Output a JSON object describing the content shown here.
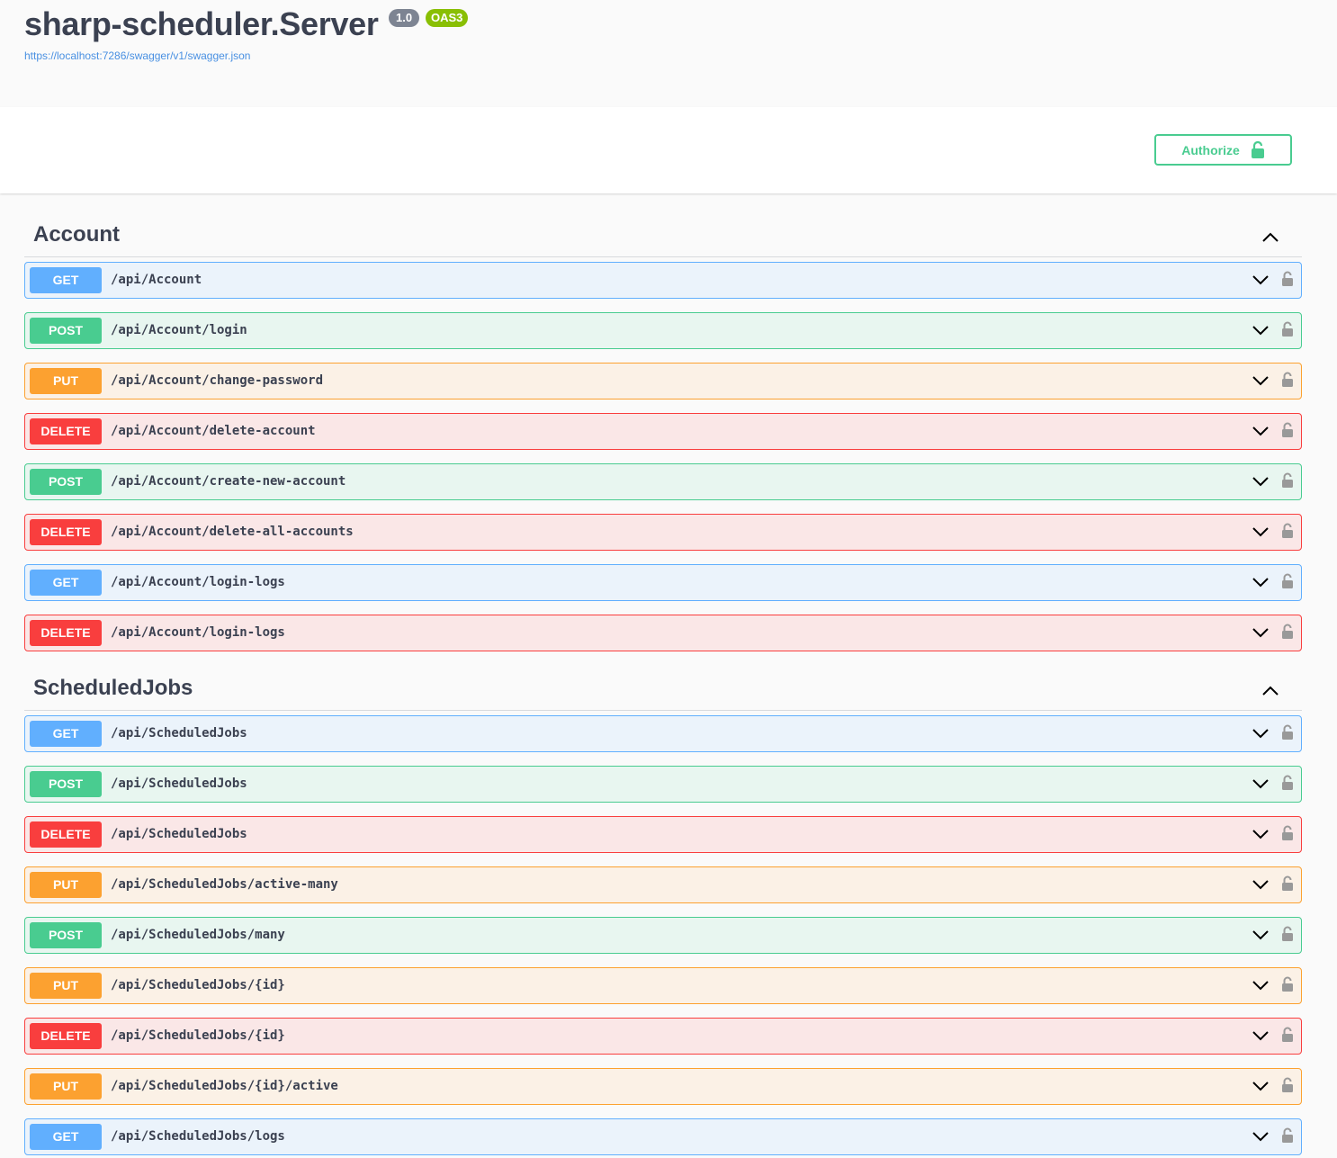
{
  "header": {
    "title": "sharp-scheduler.Server",
    "version": "1.0",
    "oas": "OAS3",
    "spec_url": "https://localhost:7286/swagger/v1/swagger.json"
  },
  "scheme": {
    "authorize_label": "Authorize"
  },
  "colors": {
    "get": "#61affe",
    "post": "#49cc90",
    "put": "#fca130",
    "delete": "#f93e3e"
  },
  "tags": [
    {
      "name": "Account",
      "operations": [
        {
          "method": "GET",
          "path": "/api/Account"
        },
        {
          "method": "POST",
          "path": "/api/Account/login"
        },
        {
          "method": "PUT",
          "path": "/api/Account/change-password"
        },
        {
          "method": "DELETE",
          "path": "/api/Account/delete-account"
        },
        {
          "method": "POST",
          "path": "/api/Account/create-new-account"
        },
        {
          "method": "DELETE",
          "path": "/api/Account/delete-all-accounts"
        },
        {
          "method": "GET",
          "path": "/api/Account/login-logs"
        },
        {
          "method": "DELETE",
          "path": "/api/Account/login-logs"
        }
      ]
    },
    {
      "name": "ScheduledJobs",
      "operations": [
        {
          "method": "GET",
          "path": "/api/ScheduledJobs"
        },
        {
          "method": "POST",
          "path": "/api/ScheduledJobs"
        },
        {
          "method": "DELETE",
          "path": "/api/ScheduledJobs"
        },
        {
          "method": "PUT",
          "path": "/api/ScheduledJobs/active-many"
        },
        {
          "method": "POST",
          "path": "/api/ScheduledJobs/many"
        },
        {
          "method": "PUT",
          "path": "/api/ScheduledJobs/{id}"
        },
        {
          "method": "DELETE",
          "path": "/api/ScheduledJobs/{id}"
        },
        {
          "method": "PUT",
          "path": "/api/ScheduledJobs/{id}/active"
        },
        {
          "method": "GET",
          "path": "/api/ScheduledJobs/logs"
        }
      ]
    }
  ]
}
